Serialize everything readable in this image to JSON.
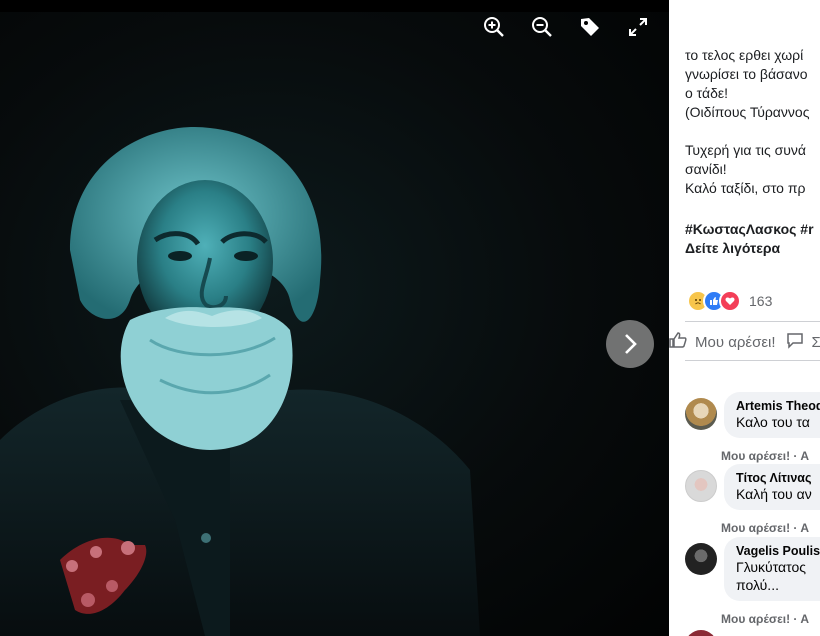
{
  "viewer": {
    "photo_alt": "",
    "toolbar": {
      "zoom_in_icon": "zoom-in-icon",
      "zoom_out_icon": "zoom-out-icon",
      "tag_icon": "tag-icon",
      "fullscreen_icon": "fullscreen-icon"
    },
    "next_icon": "chevron-right-icon"
  },
  "post": {
    "lines": [
      "το τελος ερθει χωρί",
      "γνωρίσει το βάσανο",
      "ο τάδε!",
      "(Οιδίπους Τύραννος",
      "",
      "Τυχερή για τις συνά",
      "σανίδι!",
      "Καλό ταξίδι, στο πρ"
    ],
    "hashtags": "#ΚωσταςΛασκος #r",
    "see_more": "Δείτε λιγότερα",
    "reaction_count": "163",
    "like_label": "Μου αρέσει!",
    "comment_label_partial": "Σ"
  },
  "comments": [
    {
      "name": "Artemis Theod",
      "text": "Καλο του τα",
      "meta": "Μου αρέσει! · Α",
      "extra": ""
    },
    {
      "name": "Τίτος Λίτινας",
      "text": "Καλή του αν",
      "meta": "Μου αρέσει! · Α",
      "extra": ""
    },
    {
      "name": "Vagelis Poulis",
      "text": "Γλυκύτατος",
      "meta": "Μου αρέσει! · Α",
      "extra": "πολύ..."
    }
  ],
  "colors": {
    "accent_like": "#2f7cf6",
    "accent_love": "#f33e58",
    "accent_sad": "#f7c54b",
    "photo_tint": "#2a7f86"
  }
}
